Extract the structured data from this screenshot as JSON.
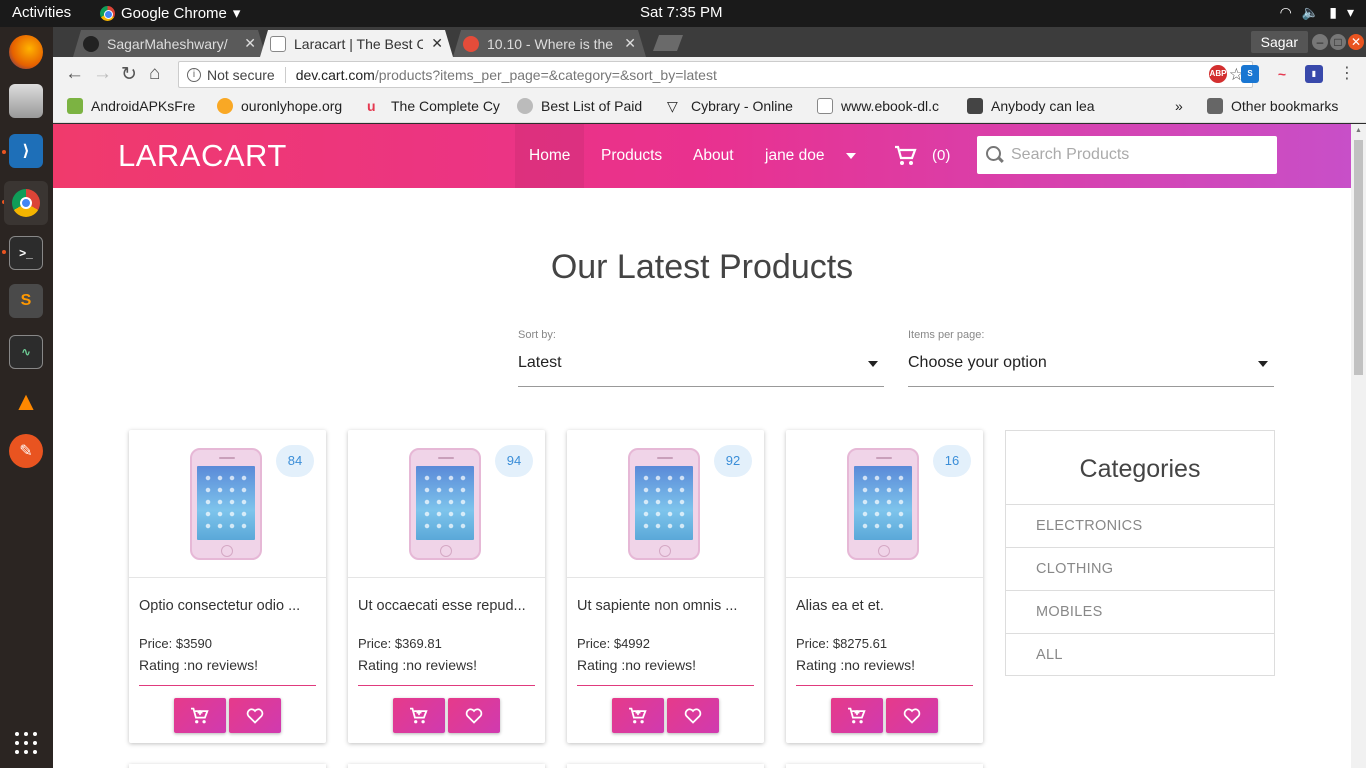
{
  "system": {
    "activities": "Activities",
    "app_name": "Google Chrome",
    "clock": "Sat  7:35 PM"
  },
  "browser": {
    "tabs": [
      {
        "title": "SagarMaheshwary/",
        "favicon_color": "#222222"
      },
      {
        "title": "Laracart | The Best C",
        "favicon_color": "#888888"
      },
      {
        "title": "10.10 - Where is the",
        "favicon_color": "#e44c3a"
      }
    ],
    "profile": "Sagar",
    "address": {
      "security": "Not secure",
      "host": "dev.cart.com",
      "path": "/products?items_per_page=&category=&sort_by=latest"
    },
    "bookmarks": [
      {
        "label": "AndroidAPKsFre",
        "color": "#7cb342"
      },
      {
        "label": "ouronlyhope.org",
        "color": "#f9a825"
      },
      {
        "label": "The Complete Cy",
        "color": "#e53950"
      },
      {
        "label": "Best List of Paid",
        "color": "#999999"
      },
      {
        "label": "Cybrary - Online",
        "color": "#333333"
      },
      {
        "label": "www.ebook-dl.c",
        "color": "#bbbbbb"
      },
      {
        "label": "Anybody can lea",
        "color": "#444444"
      }
    ],
    "more_bookmarks": "»",
    "other_bookmarks": "Other bookmarks"
  },
  "site": {
    "brand": "LARACART",
    "nav": {
      "home": "Home",
      "products": "Products",
      "about": "About",
      "user": "jane doe",
      "cart_count": "(0)"
    },
    "search_placeholder": "Search Products",
    "heading": "Our Latest Products",
    "sort": {
      "label": "Sort by:",
      "value": "Latest"
    },
    "per_page": {
      "label": "Items per page:",
      "value": "Choose your option"
    },
    "products": [
      {
        "badge": "84",
        "title": "Optio consectetur odio ...",
        "price": "Price: $3590",
        "rating": "Rating :no reviews!"
      },
      {
        "badge": "94",
        "title": "Ut occaecati esse repud...",
        "price": "Price: $369.81",
        "rating": "Rating :no reviews!"
      },
      {
        "badge": "92",
        "title": "Ut sapiente non omnis ...",
        "price": "Price: $4992",
        "rating": "Rating :no reviews!"
      },
      {
        "badge": "16",
        "title": "Alias ea et et.",
        "price": "Price: $8275.61",
        "rating": "Rating :no reviews!"
      }
    ],
    "categories": {
      "title": "Categories",
      "items": [
        "ELECTRONICS",
        "CLOTHING",
        "MOBILES",
        "ALL"
      ]
    },
    "colors": {
      "gradient_start": "#f03a6c",
      "gradient_end": "#c84fc8",
      "button": "#e0368f",
      "badge_bg": "#e3f0fb",
      "badge_text": "#3b8ed8"
    }
  }
}
